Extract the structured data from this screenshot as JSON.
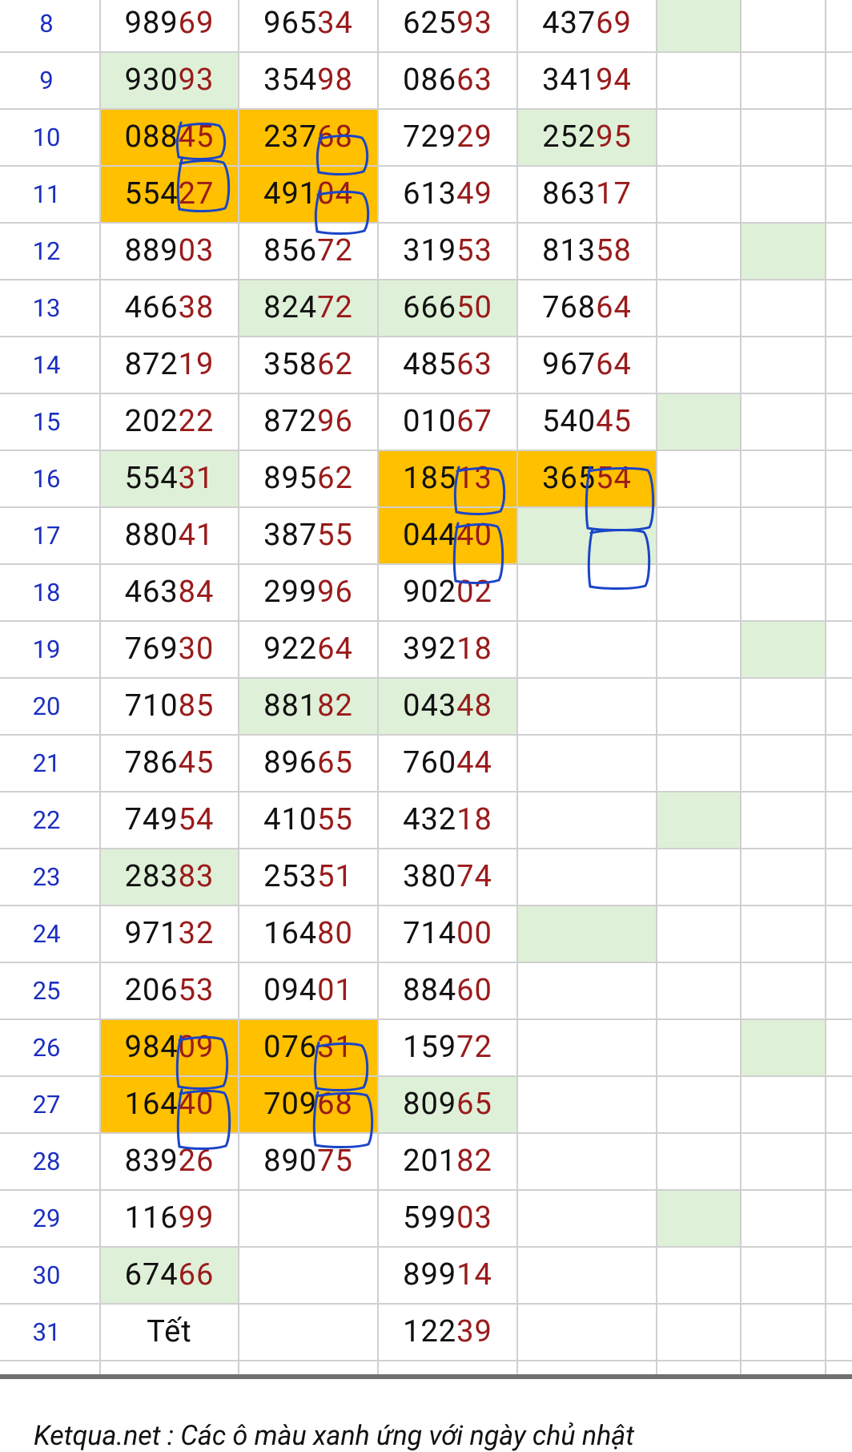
{
  "rows": [
    {
      "n": "8",
      "c": [
        {
          "h": "989",
          "t": "69"
        },
        {
          "h": "965",
          "t": "34"
        },
        {
          "h": "625",
          "t": "93"
        },
        {
          "h": "437",
          "t": "69"
        }
      ]
    },
    {
      "n": "9",
      "c": [
        {
          "h": "930",
          "t": "93"
        },
        {
          "h": "354",
          "t": "98"
        },
        {
          "h": "086",
          "t": "63"
        },
        {
          "h": "341",
          "t": "94"
        }
      ]
    },
    {
      "n": "10",
      "c": [
        {
          "h": "088",
          "t": "45"
        },
        {
          "h": "237",
          "t": "68"
        },
        {
          "h": "729",
          "t": "29"
        },
        {
          "h": "252",
          "t": "95"
        }
      ]
    },
    {
      "n": "11",
      "c": [
        {
          "h": "554",
          "t": "27"
        },
        {
          "h": "491",
          "t": "04"
        },
        {
          "h": "613",
          "t": "49"
        },
        {
          "h": "863",
          "t": "17"
        }
      ]
    },
    {
      "n": "12",
      "c": [
        {
          "h": "889",
          "t": "03"
        },
        {
          "h": "856",
          "t": "72"
        },
        {
          "h": "319",
          "t": "53"
        },
        {
          "h": "813",
          "t": "58"
        }
      ]
    },
    {
      "n": "13",
      "c": [
        {
          "h": "466",
          "t": "38"
        },
        {
          "h": "824",
          "t": "72"
        },
        {
          "h": "666",
          "t": "50"
        },
        {
          "h": "768",
          "t": "64"
        }
      ]
    },
    {
      "n": "14",
      "c": [
        {
          "h": "872",
          "t": "19"
        },
        {
          "h": "358",
          "t": "62"
        },
        {
          "h": "485",
          "t": "63"
        },
        {
          "h": "967",
          "t": "64"
        }
      ]
    },
    {
      "n": "15",
      "c": [
        {
          "h": "202",
          "t": "22"
        },
        {
          "h": "872",
          "t": "96"
        },
        {
          "h": "010",
          "t": "67"
        },
        {
          "h": "540",
          "t": "45"
        }
      ]
    },
    {
      "n": "16",
      "c": [
        {
          "h": "554",
          "t": "31"
        },
        {
          "h": "895",
          "t": "62"
        },
        {
          "h": "185",
          "t": "13"
        },
        {
          "h": "365",
          "t": "54"
        }
      ]
    },
    {
      "n": "17",
      "c": [
        {
          "h": "880",
          "t": "41"
        },
        {
          "h": "387",
          "t": "55"
        },
        {
          "h": "044",
          "t": "40"
        },
        null
      ]
    },
    {
      "n": "18",
      "c": [
        {
          "h": "463",
          "t": "84"
        },
        {
          "h": "299",
          "t": "96"
        },
        {
          "h": "902",
          "t": "02"
        },
        null
      ]
    },
    {
      "n": "19",
      "c": [
        {
          "h": "769",
          "t": "30"
        },
        {
          "h": "922",
          "t": "64"
        },
        {
          "h": "392",
          "t": "18"
        },
        null
      ]
    },
    {
      "n": "20",
      "c": [
        {
          "h": "710",
          "t": "85"
        },
        {
          "h": "881",
          "t": "82"
        },
        {
          "h": "043",
          "t": "48"
        },
        null
      ]
    },
    {
      "n": "21",
      "c": [
        {
          "h": "786",
          "t": "45"
        },
        {
          "h": "896",
          "t": "65"
        },
        {
          "h": "760",
          "t": "44"
        },
        null
      ]
    },
    {
      "n": "22",
      "c": [
        {
          "h": "749",
          "t": "54"
        },
        {
          "h": "410",
          "t": "55"
        },
        {
          "h": "432",
          "t": "18"
        },
        null
      ]
    },
    {
      "n": "23",
      "c": [
        {
          "h": "283",
          "t": "83"
        },
        {
          "h": "253",
          "t": "51"
        },
        {
          "h": "380",
          "t": "74"
        },
        null
      ]
    },
    {
      "n": "24",
      "c": [
        {
          "h": "971",
          "t": "32"
        },
        {
          "h": "164",
          "t": "80"
        },
        {
          "h": "714",
          "t": "00"
        },
        null
      ]
    },
    {
      "n": "25",
      "c": [
        {
          "h": "206",
          "t": "53"
        },
        {
          "h": "094",
          "t": "01"
        },
        {
          "h": "884",
          "t": "60"
        },
        null
      ]
    },
    {
      "n": "26",
      "c": [
        {
          "h": "984",
          "t": "09"
        },
        {
          "h": "076",
          "t": "31"
        },
        {
          "h": "159",
          "t": "72"
        },
        null
      ]
    },
    {
      "n": "27",
      "c": [
        {
          "h": "164",
          "t": "40"
        },
        {
          "h": "709",
          "t": "68"
        },
        {
          "h": "809",
          "t": "65"
        },
        null
      ]
    },
    {
      "n": "28",
      "c": [
        {
          "h": "839",
          "t": "26"
        },
        {
          "h": "890",
          "t": "75"
        },
        {
          "h": "201",
          "t": "82"
        },
        null
      ]
    },
    {
      "n": "29",
      "c": [
        {
          "h": "116",
          "t": "99"
        },
        null,
        {
          "h": "599",
          "t": "03"
        },
        null
      ]
    },
    {
      "n": "30",
      "c": [
        {
          "h": "674",
          "t": "66"
        },
        null,
        {
          "h": "899",
          "t": "14"
        },
        null
      ]
    },
    {
      "n": "31",
      "c": [
        {
          "h": "Tết",
          "t": ""
        },
        null,
        {
          "h": "122",
          "t": "39"
        },
        null
      ]
    }
  ],
  "highlights": {
    "green": [
      [
        0,
        4
      ],
      [
        1,
        0
      ],
      [
        2,
        3
      ],
      [
        4,
        5
      ],
      [
        5,
        1
      ],
      [
        5,
        2
      ],
      [
        7,
        4
      ],
      [
        8,
        0
      ],
      [
        9,
        3
      ],
      [
        11,
        5
      ],
      [
        12,
        1
      ],
      [
        12,
        2
      ],
      [
        14,
        4
      ],
      [
        15,
        0
      ],
      [
        16,
        3
      ],
      [
        18,
        5
      ],
      [
        19,
        2
      ],
      [
        21,
        4
      ],
      [
        22,
        0
      ]
    ],
    "orange": [
      [
        2,
        0
      ],
      [
        2,
        1
      ],
      [
        3,
        0
      ],
      [
        3,
        1
      ],
      [
        8,
        2
      ],
      [
        8,
        3
      ],
      [
        9,
        2
      ],
      [
        18,
        0
      ],
      [
        18,
        1
      ],
      [
        19,
        0
      ],
      [
        19,
        1
      ]
    ]
  },
  "colors": {
    "green": "#dff0d8",
    "orange": "#ffc000",
    "rownum": "#1b2fbf",
    "tail": "#9a1b1b",
    "pen": "#1a45c8"
  },
  "footer_text": "Ketqua.net : Các ô màu xanh ứng với ngày chủ nhật"
}
